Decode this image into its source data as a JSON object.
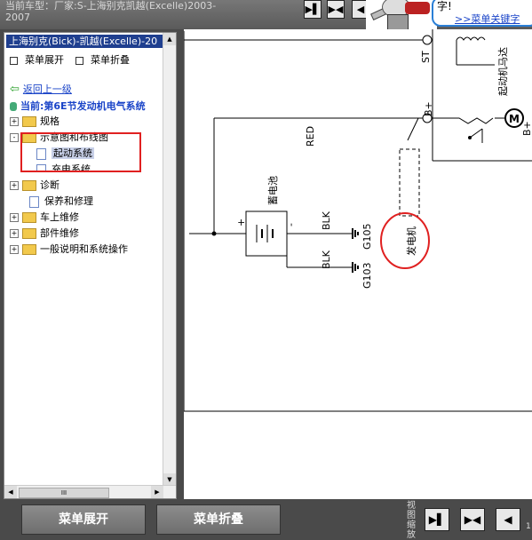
{
  "header": {
    "model_line1": "当前车型：厂家:S-上海别克凯越(Excelle)2003-",
    "model_line2": "2007",
    "btn_next": "▶▌",
    "btn_fit": "▶◀",
    "btn_prev": "◀"
  },
  "tip_bubble": {
    "text": "字!",
    "link": ">>菜单关键字"
  },
  "sidebar": {
    "title": "上海别克(Bick)-凯越(Excelle)-20",
    "expand_menu": "菜单展开",
    "collapse_menu": "菜单折叠",
    "back_link": "返回上一级",
    "current": "当前:第6E节发动机电气系统",
    "tree": [
      {
        "label": "规格",
        "toggle": "+",
        "level": 0
      },
      {
        "label": "示意图和布线图",
        "toggle": "-",
        "level": 0
      },
      {
        "label": "起动系统",
        "level": 1,
        "selected": true
      },
      {
        "label": "充电系统",
        "level": 1
      },
      {
        "label": "诊断",
        "toggle": "+",
        "level": 0
      },
      {
        "label": "保养和修理",
        "level": 0
      },
      {
        "label": "车上维修",
        "toggle": "+",
        "level": 0
      },
      {
        "label": "部件维修",
        "toggle": "+",
        "level": 0
      },
      {
        "label": "一般说明和系统操作",
        "toggle": "+",
        "level": 0
      }
    ],
    "scroll_thumb_glyph": "III"
  },
  "diagram": {
    "labels": {
      "battery": "蓄电池",
      "plus": "+",
      "minus": "-",
      "red": "RED",
      "blk1": "BLK",
      "blk2": "BLK",
      "g105": "G105",
      "g103": "G103",
      "generator": "发电机",
      "st": "ST",
      "bplus": "B+",
      "bplus2": "B+",
      "motor_partial": "起动机马达"
    }
  },
  "footer": {
    "expand_button": "菜单展开",
    "collapse_button": "菜单折叠",
    "view_label": "视图缩放",
    "page_partial": "1"
  },
  "colors": {
    "highlight_red": "#e02020",
    "link_blue": "#1a44c8",
    "title_bar": "#1f3f8f"
  }
}
